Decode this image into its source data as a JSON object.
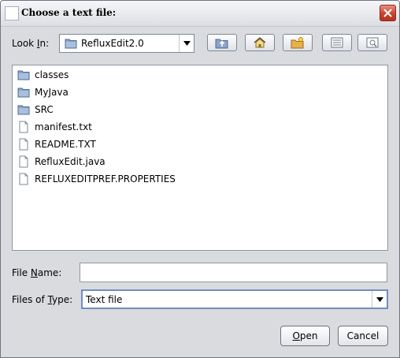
{
  "window": {
    "title": "Choose a text file:"
  },
  "lookin": {
    "label_pre": "Look ",
    "label_mn": "I",
    "label_post": "n:",
    "value": "RefluxEdit2.0"
  },
  "toolbar": {
    "buttons": [
      {
        "icon": "up-folder-icon"
      },
      {
        "icon": "home-icon"
      },
      {
        "icon": "new-folder-icon"
      },
      {
        "icon": "list-view-icon"
      },
      {
        "icon": "details-view-icon"
      }
    ]
  },
  "files": {
    "items": [
      {
        "name": "classes",
        "type": "folder"
      },
      {
        "name": "MyJava",
        "type": "folder"
      },
      {
        "name": "SRC",
        "type": "folder"
      },
      {
        "name": "manifest.txt",
        "type": "file"
      },
      {
        "name": "README.TXT",
        "type": "file"
      },
      {
        "name": "RefluxEdit.java",
        "type": "file"
      },
      {
        "name": "REFLUXEDITPREF.PROPERTIES",
        "type": "file"
      }
    ]
  },
  "filename": {
    "label_pre": "File ",
    "label_mn": "N",
    "label_post": "ame:",
    "value": ""
  },
  "filetype": {
    "label_pre": "Files of ",
    "label_mn": "T",
    "label_post": "ype:",
    "value": "Text file"
  },
  "buttons": {
    "open_mn": "O",
    "open_rest": "pen",
    "cancel": "Cancel"
  },
  "colors": {
    "folder": "#8aa4c8",
    "close": "#c8432d"
  }
}
